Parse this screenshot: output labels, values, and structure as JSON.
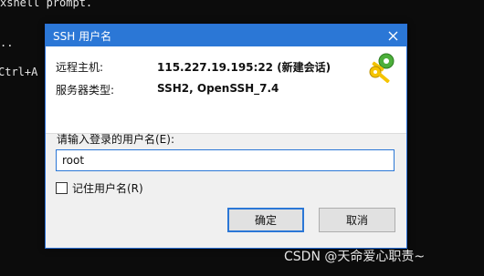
{
  "terminal": {
    "line1": "xshell prompt.",
    "line2": "..",
    "line3": "Ctrl+A"
  },
  "dialog": {
    "title": "SSH 用户名",
    "remote_host_label": "远程主机:",
    "remote_host_value": "115.227.19.195:22 (新建会话)",
    "server_type_label": "服务器类型:",
    "server_type_value": "SSH2, OpenSSH_7.4",
    "username_prompt": "请输入登录的用户名(E):",
    "username_value": "root",
    "remember_label": "记住用户名(R)",
    "ok_label": "确定",
    "cancel_label": "取消"
  },
  "watermark": "CSDN @天命爱心职责~",
  "colors": {
    "titlebar": "#2b77d6",
    "terminal_bg": "#0c0c0c"
  },
  "icons": {
    "close": "close-icon",
    "keys": "keys-icon"
  }
}
